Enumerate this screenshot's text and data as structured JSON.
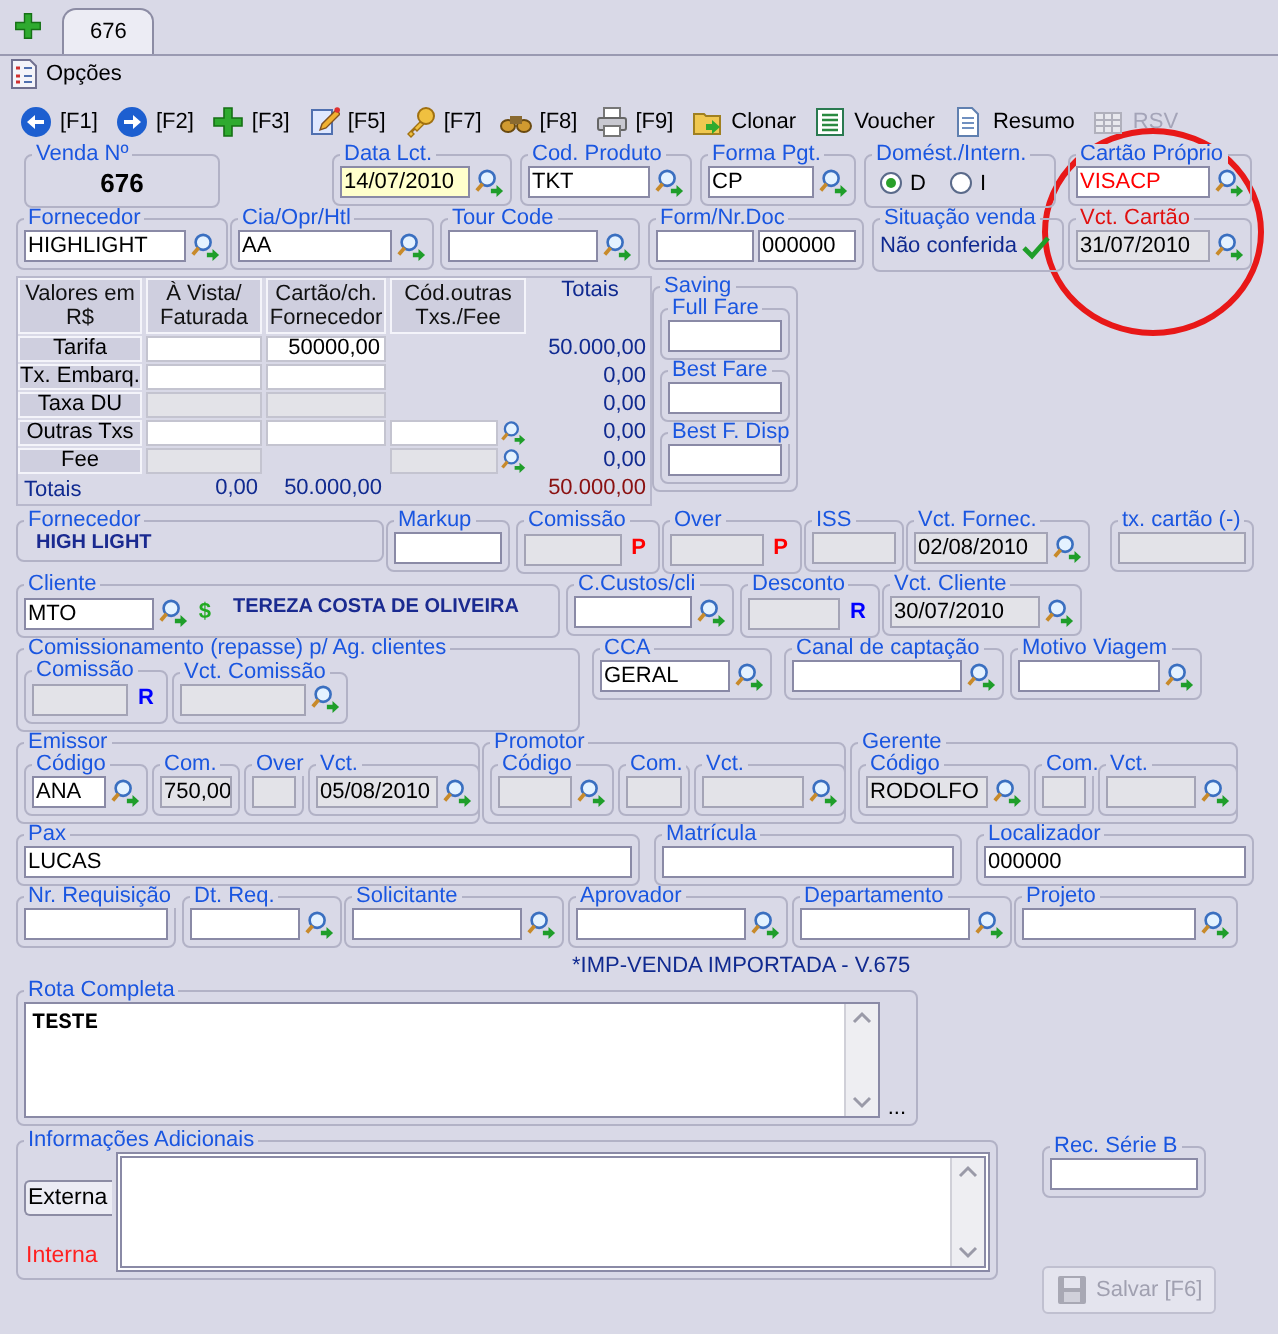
{
  "tabs": [
    {
      "label": "676",
      "selected": true
    }
  ],
  "options_menu": {
    "label": "Opções"
  },
  "toolbar": [
    {
      "label": "[F1]",
      "disabled": false
    },
    {
      "label": "[F2]",
      "disabled": false
    },
    {
      "label": "[F3]",
      "disabled": false
    },
    {
      "label": "[F5]",
      "disabled": false
    },
    {
      "label": "[F7]",
      "disabled": false
    },
    {
      "label": "[F8]",
      "disabled": false
    },
    {
      "label": "[F9]",
      "disabled": false
    },
    {
      "label": "Clonar",
      "disabled": false
    },
    {
      "label": "Voucher",
      "disabled": false
    },
    {
      "label": "Resumo",
      "disabled": false
    },
    {
      "label": "RSV",
      "disabled": true
    }
  ],
  "header_rows": [
    [
      {
        "label": "Venda Nº",
        "items": [
          {
            "kind": "value",
            "text": "676"
          }
        ]
      },
      {
        "label": "Data Lct.",
        "items": [
          {
            "kind": "highlight_field",
            "value": "14/07/2010",
            "readonly": false,
            "lookup": true
          }
        ]
      },
      {
        "label": "Cod. Produto",
        "items": [
          {
            "kind": "field",
            "value": "TKT",
            "readonly": false,
            "lookup": true
          }
        ]
      },
      {
        "label": "Forma Pgt.",
        "items": [
          {
            "kind": "field",
            "value": "CP",
            "readonly": false,
            "lookup": true
          }
        ]
      },
      {
        "label": "Domést./Intern.",
        "items": [
          {
            "kind": "radio",
            "label": "D",
            "selected": true
          },
          {
            "kind": "radio",
            "label": "I",
            "selected": false
          }
        ]
      },
      {
        "label": "Cartão Próprio",
        "items": [
          {
            "kind": "alert_field",
            "value": "VISACP",
            "readonly": false,
            "lookup": true
          }
        ]
      }
    ],
    [
      {
        "label": "Fornecedor",
        "items": [
          {
            "kind": "field",
            "value": "HIGHLIGHT",
            "readonly": false,
            "lookup": true
          }
        ]
      },
      {
        "label": "Cia/Opr/Htl",
        "items": [
          {
            "kind": "field",
            "value": "AA",
            "readonly": false,
            "lookup": true
          }
        ]
      },
      {
        "label": "Tour Code",
        "items": [
          {
            "kind": "field",
            "readonly": false,
            "lookup": true
          }
        ]
      },
      {
        "label": "Form/Nr.Doc",
        "items": [
          {
            "kind": "field",
            "readonly": false,
            "lookup": false
          },
          {
            "kind": "field",
            "value": "000000",
            "readonly": false,
            "lookup": false
          }
        ]
      },
      {
        "label": "Situação venda",
        "items": [
          {
            "kind": "status",
            "text": "Não conferida",
            "checked": true
          }
        ]
      },
      {
        "label": "Vct. Cartão",
        "kind": "alert_group",
        "items": [
          {
            "kind": "field",
            "value": "31/07/2010",
            "readonly": true,
            "lookup": true
          }
        ]
      }
    ]
  ],
  "values_table": {
    "columns": [
      "Valores em R$",
      "À Vista/ Faturada",
      "Cartão/ch. Fornecedor",
      "Cód.outras Txs./Fee",
      "Totais"
    ],
    "rows": [
      {
        "cells": [
          {
            "kind": "label",
            "text": "Tarifa"
          },
          {
            "kind": "input",
            "readonly": false
          },
          {
            "kind": "input",
            "value": "50000,00",
            "readonly": false
          },
          {
            "kind": "blank"
          },
          {
            "kind": "total",
            "text": "50.000,00"
          }
        ]
      },
      {
        "cells": [
          {
            "kind": "label",
            "text": "Tx. Embarq."
          },
          {
            "kind": "input",
            "readonly": false
          },
          {
            "kind": "input",
            "readonly": false
          },
          {
            "kind": "blank"
          },
          {
            "kind": "total",
            "text": "0,00"
          }
        ]
      },
      {
        "cells": [
          {
            "kind": "label",
            "text": "Taxa DU"
          },
          {
            "kind": "input",
            "readonly": true
          },
          {
            "kind": "input",
            "readonly": true
          },
          {
            "kind": "blank"
          },
          {
            "kind": "total",
            "text": "0,00"
          }
        ]
      },
      {
        "cells": [
          {
            "kind": "label",
            "text": "Outras Txs"
          },
          {
            "kind": "input",
            "readonly": false
          },
          {
            "kind": "input",
            "readonly": false
          },
          {
            "kind": "lookup",
            "readonly": false
          },
          {
            "kind": "total",
            "text": "0,00"
          }
        ]
      },
      {
        "cells": [
          {
            "kind": "label",
            "text": "Fee"
          },
          {
            "kind": "input",
            "readonly": true
          },
          {
            "kind": "blank"
          },
          {
            "kind": "lookup",
            "readonly": true
          },
          {
            "kind": "total",
            "text": "0,00"
          }
        ]
      },
      {
        "cells": [
          {
            "kind": "sum_label",
            "text": "Totais"
          },
          {
            "kind": "sum",
            "text": "0,00"
          },
          {
            "kind": "sum",
            "text": "50.000,00"
          },
          {
            "kind": "blank"
          },
          {
            "kind": "grand_total",
            "text": "50.000,00"
          }
        ]
      }
    ]
  },
  "saving": {
    "label": "Saving",
    "items": [
      {
        "kind": "group",
        "label": "Full Fare",
        "items": [
          {
            "kind": "field",
            "readonly": false,
            "lookup": false
          }
        ]
      },
      {
        "kind": "group",
        "label": "Best Fare",
        "items": [
          {
            "kind": "field",
            "readonly": false,
            "lookup": false
          }
        ]
      },
      {
        "kind": "group",
        "label": "Best F. Disp",
        "items": [
          {
            "kind": "field",
            "readonly": false,
            "lookup": false
          }
        ]
      }
    ]
  },
  "detail_rows": [
    [
      {
        "label": "Fornecedor",
        "items": [
          {
            "kind": "note",
            "text": "HIGH LIGHT"
          }
        ]
      },
      {
        "label": "Markup",
        "items": [
          {
            "kind": "field",
            "readonly": false,
            "lookup": false
          }
        ]
      },
      {
        "label": "Comissão",
        "items": [
          {
            "kind": "field",
            "readonly": true,
            "lookup": false
          },
          {
            "kind": "tag",
            "text": "P",
            "color": "#ff0000"
          }
        ]
      },
      {
        "label": "Over",
        "items": [
          {
            "kind": "field",
            "readonly": true,
            "lookup": false
          },
          {
            "kind": "tag",
            "text": "P",
            "color": "#ff0000"
          }
        ]
      },
      {
        "label": "ISS",
        "items": [
          {
            "kind": "field",
            "readonly": true,
            "lookup": false
          }
        ]
      },
      {
        "label": "Vct. Fornec.",
        "items": [
          {
            "kind": "field",
            "value": "02/08/2010",
            "readonly": true,
            "lookup": true
          }
        ]
      },
      {
        "label": "tx. cartão (-)",
        "items": [
          {
            "kind": "field",
            "readonly": true,
            "lookup": false
          }
        ]
      }
    ],
    [
      {
        "label": "Cliente",
        "items": [
          {
            "kind": "field",
            "value": "MTO",
            "readonly": false,
            "lookup": true
          },
          {
            "kind": "tag",
            "text": "$",
            "color": "#22aa22"
          },
          {
            "kind": "note",
            "text": "TEREZA COSTA DE OLIVEIRA"
          }
        ]
      },
      {
        "label": "C.Custos/cli",
        "items": [
          {
            "kind": "field",
            "readonly": false,
            "lookup": true
          }
        ]
      },
      {
        "label": "Desconto",
        "items": [
          {
            "kind": "field",
            "readonly": true,
            "lookup": false
          },
          {
            "kind": "tag",
            "text": "R",
            "color": "#0000ff"
          }
        ]
      },
      {
        "label": "Vct. Cliente",
        "items": [
          {
            "kind": "field",
            "value": "30/07/2010",
            "readonly": true,
            "lookup": true
          }
        ]
      }
    ],
    [
      {
        "label": "Comissionamento (repasse) p/ Ag. clientes",
        "items": [
          {
            "kind": "group",
            "label": "Comissão",
            "items": [
              {
                "kind": "field",
                "readonly": true,
                "lookup": false
              },
              {
                "kind": "tag",
                "text": "R",
                "color": "#0000ff"
              }
            ]
          },
          {
            "kind": "group",
            "label": "Vct. Comissão",
            "items": [
              {
                "kind": "field",
                "readonly": true,
                "lookup": true
              }
            ]
          }
        ]
      },
      {
        "label": "CCA",
        "items": [
          {
            "kind": "field",
            "value": "GERAL",
            "readonly": false,
            "lookup": true
          }
        ]
      },
      {
        "label": "Canal de captação",
        "items": [
          {
            "kind": "field",
            "readonly": false,
            "lookup": true
          }
        ]
      },
      {
        "label": "Motivo Viagem",
        "items": [
          {
            "kind": "field",
            "readonly": false,
            "lookup": true
          }
        ]
      }
    ],
    [
      {
        "label": "Emissor",
        "items": [
          {
            "kind": "group",
            "label": "Código",
            "items": [
              {
                "kind": "field",
                "value": "ANA",
                "readonly": false,
                "lookup": true
              }
            ]
          },
          {
            "kind": "group",
            "label": "Com.",
            "items": [
              {
                "kind": "field",
                "value": "750,00",
                "readonly": true,
                "lookup": false
              }
            ]
          },
          {
            "kind": "group",
            "label": "Over",
            "items": [
              {
                "kind": "field",
                "readonly": true,
                "lookup": false
              }
            ]
          },
          {
            "kind": "group",
            "label": "Vct.",
            "items": [
              {
                "kind": "field",
                "value": "05/08/2010",
                "readonly": true,
                "lookup": true
              }
            ]
          }
        ]
      },
      {
        "label": "Promotor",
        "items": [
          {
            "kind": "group",
            "label": "Código",
            "items": [
              {
                "kind": "field",
                "readonly": true,
                "lookup": true
              }
            ]
          },
          {
            "kind": "group",
            "label": "Com.",
            "items": [
              {
                "kind": "field",
                "readonly": true,
                "lookup": false
              }
            ]
          },
          {
            "kind": "group",
            "label": "Vct.",
            "items": [
              {
                "kind": "field",
                "readonly": true,
                "lookup": true
              }
            ]
          }
        ]
      },
      {
        "label": "Gerente",
        "items": [
          {
            "kind": "group",
            "label": "Código",
            "items": [
              {
                "kind": "field",
                "value": "RODOLFO",
                "readonly": true,
                "lookup": true
              }
            ]
          },
          {
            "kind": "group",
            "label": "Com.",
            "items": [
              {
                "kind": "field",
                "readonly": true,
                "lookup": false
              }
            ]
          },
          {
            "kind": "group",
            "label": "Vct.",
            "items": [
              {
                "kind": "field",
                "readonly": true,
                "lookup": true
              }
            ]
          }
        ]
      }
    ],
    [
      {
        "label": "Pax",
        "items": [
          {
            "kind": "field",
            "value": "LUCAS",
            "readonly": false,
            "lookup": false
          }
        ]
      },
      {
        "label": "Matrícula",
        "items": [
          {
            "kind": "field",
            "readonly": false,
            "lookup": false
          }
        ]
      },
      {
        "label": "Localizador",
        "items": [
          {
            "kind": "field",
            "value": "000000",
            "readonly": false,
            "lookup": false
          }
        ]
      }
    ],
    [
      {
        "label": "Nr. Requisição",
        "items": [
          {
            "kind": "field",
            "readonly": false,
            "lookup": false
          }
        ]
      },
      {
        "label": "Dt. Req.",
        "items": [
          {
            "kind": "field",
            "readonly": false,
            "lookup": true
          }
        ]
      },
      {
        "label": "Solicitante",
        "items": [
          {
            "kind": "field",
            "readonly": false,
            "lookup": true
          }
        ]
      },
      {
        "label": "Aprovador",
        "items": [
          {
            "kind": "field",
            "readonly": false,
            "lookup": true
          }
        ]
      },
      {
        "label": "Departamento",
        "items": [
          {
            "kind": "field",
            "readonly": false,
            "lookup": true
          }
        ]
      },
      {
        "label": "Projeto",
        "items": [
          {
            "kind": "field",
            "readonly": false,
            "lookup": true
          }
        ]
      }
    ]
  ],
  "import_note": "*IMP-VENDA IMPORTADA - V.675",
  "route": {
    "label": "Rota Completa",
    "value": "TESTE",
    "more": "..."
  },
  "additional_info": {
    "label": "Informações Adicionais",
    "tabs": [
      {
        "label": "Externa",
        "selected": true,
        "alert": false
      },
      {
        "label": "Interna",
        "selected": false,
        "alert": true
      }
    ]
  },
  "rec_serie_b": {
    "label": "Rec. Série B"
  },
  "save_button": {
    "label": "Salvar [F6]",
    "disabled": true
  }
}
